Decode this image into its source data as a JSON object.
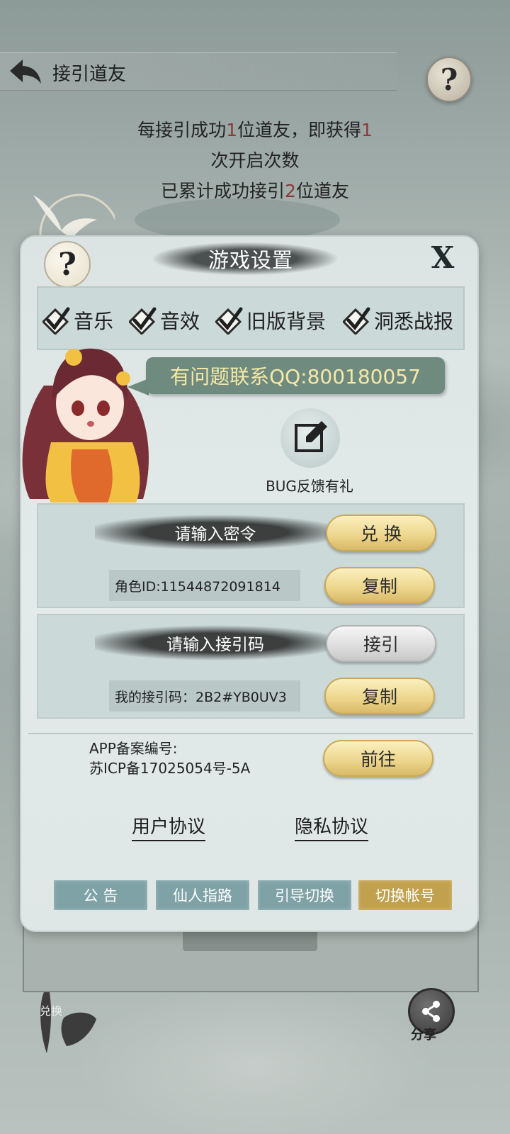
{
  "top_bar": {
    "title": "接引道友"
  },
  "info": {
    "line1_prefix": "每接引成功",
    "line1_num1": "1",
    "line1_mid": "位道友，即获得",
    "line1_num2": "1",
    "line2": "次开启次数",
    "line3_prefix": "已累计成功接引",
    "line3_num": "2",
    "line3_suffix": "位道友"
  },
  "dialog": {
    "title": "游戏设置",
    "help_glyph": "?",
    "close_glyph": "X",
    "options": [
      {
        "label": "音乐",
        "checked": true
      },
      {
        "label": "音效",
        "checked": true
      },
      {
        "label": "旧版背景",
        "checked": true
      },
      {
        "label": "洞悉战报",
        "checked": true
      }
    ],
    "qq_contact": "有问题联系QQ:800180057",
    "bug_label": "BUG反馈有礼",
    "redeem": {
      "prompt": "请输入密令",
      "button": "兑 换",
      "role_id": "角色ID:11544872091814",
      "copy_button": "复制"
    },
    "referral": {
      "prompt": "请输入接引码",
      "button": "接引",
      "my_code": "我的接引码：2B2#YB0UV3",
      "copy_button": "复制"
    },
    "icp": {
      "line1": "APP备案编号:",
      "line2": "苏ICP备17025054号-5A",
      "button": "前往"
    },
    "links": {
      "user_agreement": "用户协议",
      "privacy": "隐私协议"
    },
    "bottom_buttons": [
      "公 告",
      "仙人指路",
      "引导切换",
      "切换帐号"
    ]
  },
  "side": {
    "redeem_label": "兑换",
    "share_label": "分享"
  },
  "colors": {
    "accent_gold": "#ecd48a",
    "bubble_green": "#6f8b80",
    "qq_text": "#f6e8a6",
    "bottom_btn": "#7ea2a6",
    "bottom_btn_active": "#c2a14e"
  }
}
